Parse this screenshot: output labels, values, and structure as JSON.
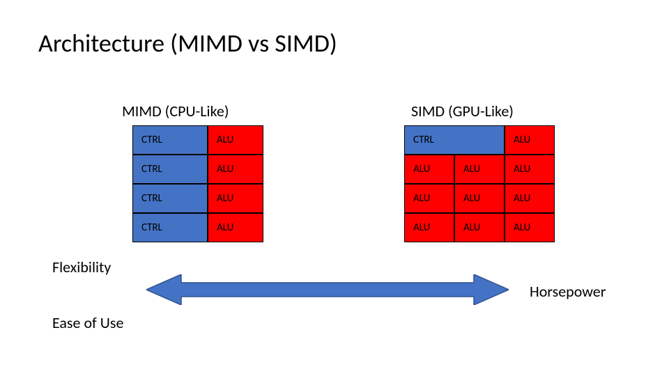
{
  "title": "Architecture (MIMD vs SIMD)",
  "mimd": {
    "heading": "MIMD (CPU-Like)",
    "rows": [
      [
        "CTRL",
        "ALU"
      ],
      [
        "CTRL",
        "ALU"
      ],
      [
        "CTRL",
        "ALU"
      ],
      [
        "CTRL",
        "ALU"
      ]
    ]
  },
  "simd": {
    "heading": "SIMD (GPU-Like)",
    "rows": [
      [
        "CTRL_WIDE",
        "ALU"
      ],
      [
        "ALU",
        "ALU",
        "ALU"
      ],
      [
        "ALU",
        "ALU",
        "ALU"
      ],
      [
        "ALU",
        "ALU",
        "ALU"
      ]
    ],
    "ctrl_label": "CTRL",
    "alu_label": "ALU"
  },
  "labels": {
    "flexibility": "Flexibility",
    "ease": "Ease of Use",
    "horsepower": "Horsepower"
  },
  "colors": {
    "ctrl_bg": "#4472c4",
    "alu_bg": "#ff0000",
    "arrow_fill": "#4472c4",
    "arrow_stroke": "#2f528f"
  }
}
